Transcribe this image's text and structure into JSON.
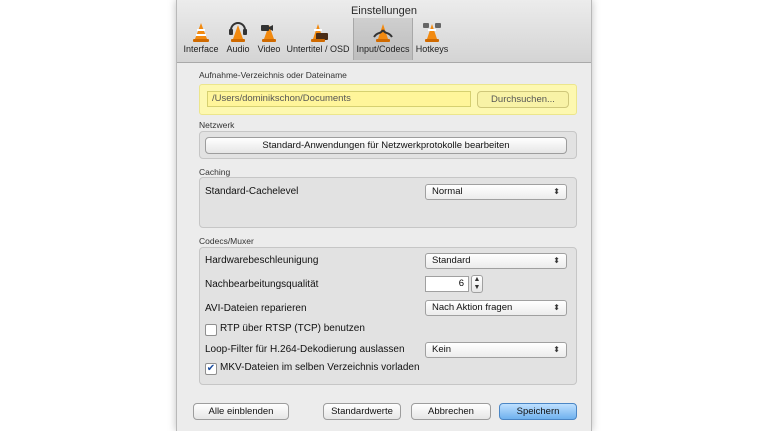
{
  "window": {
    "title": "Einstellungen"
  },
  "tabs": [
    {
      "label": "Interface",
      "icon": "interface-cone-icon"
    },
    {
      "label": "Audio",
      "icon": "audio-cone-icon"
    },
    {
      "label": "Video",
      "icon": "video-cone-icon"
    },
    {
      "label": "Untertitel / OSD",
      "icon": "subtitle-cone-icon"
    },
    {
      "label": "Input/Codecs",
      "icon": "input-codecs-cone-icon",
      "active": true
    },
    {
      "label": "Hotkeys",
      "icon": "hotkeys-cone-icon"
    }
  ],
  "record": {
    "section_label": "Aufnahme-Verzeichnis oder Dateiname",
    "path_value": "/Users/dominikschon/Documents",
    "browse_label": "Durchsuchen...",
    "highlight_color": "#fdf8b0"
  },
  "network": {
    "section_label": "Netzwerk",
    "button_label": "Standard-Anwendungen für Netzwerkprotokolle bearbeiten"
  },
  "caching": {
    "section_label": "Caching",
    "cache_label": "Standard-Cachelevel",
    "cache_value": "Normal"
  },
  "codecs": {
    "section_label": "Codecs/Muxer",
    "hw_label": "Hardwarebeschleunigung",
    "hw_value": "Standard",
    "pp_label": "Nachbearbeitungsqualität",
    "pp_value": "6",
    "avi_label": "AVI-Dateien reparieren",
    "avi_value": "Nach Aktion fragen",
    "rtsp_label": "RTP über RTSP (TCP) benutzen",
    "rtsp_checked": false,
    "loop_label": "Loop-Filter für H.264-Dekodierung auslassen",
    "loop_value": "Kein",
    "mkv_label": "MKV-Dateien im selben Verzeichnis vorladen",
    "mkv_checked": true
  },
  "footer": {
    "show_all_label": "Alle einblenden",
    "defaults_label": "Standardwerte",
    "cancel_label": "Abbrechen",
    "save_label": "Speichern"
  },
  "colors": {
    "accent": "#6fb1ee",
    "cone_orange": "#f28a10"
  }
}
